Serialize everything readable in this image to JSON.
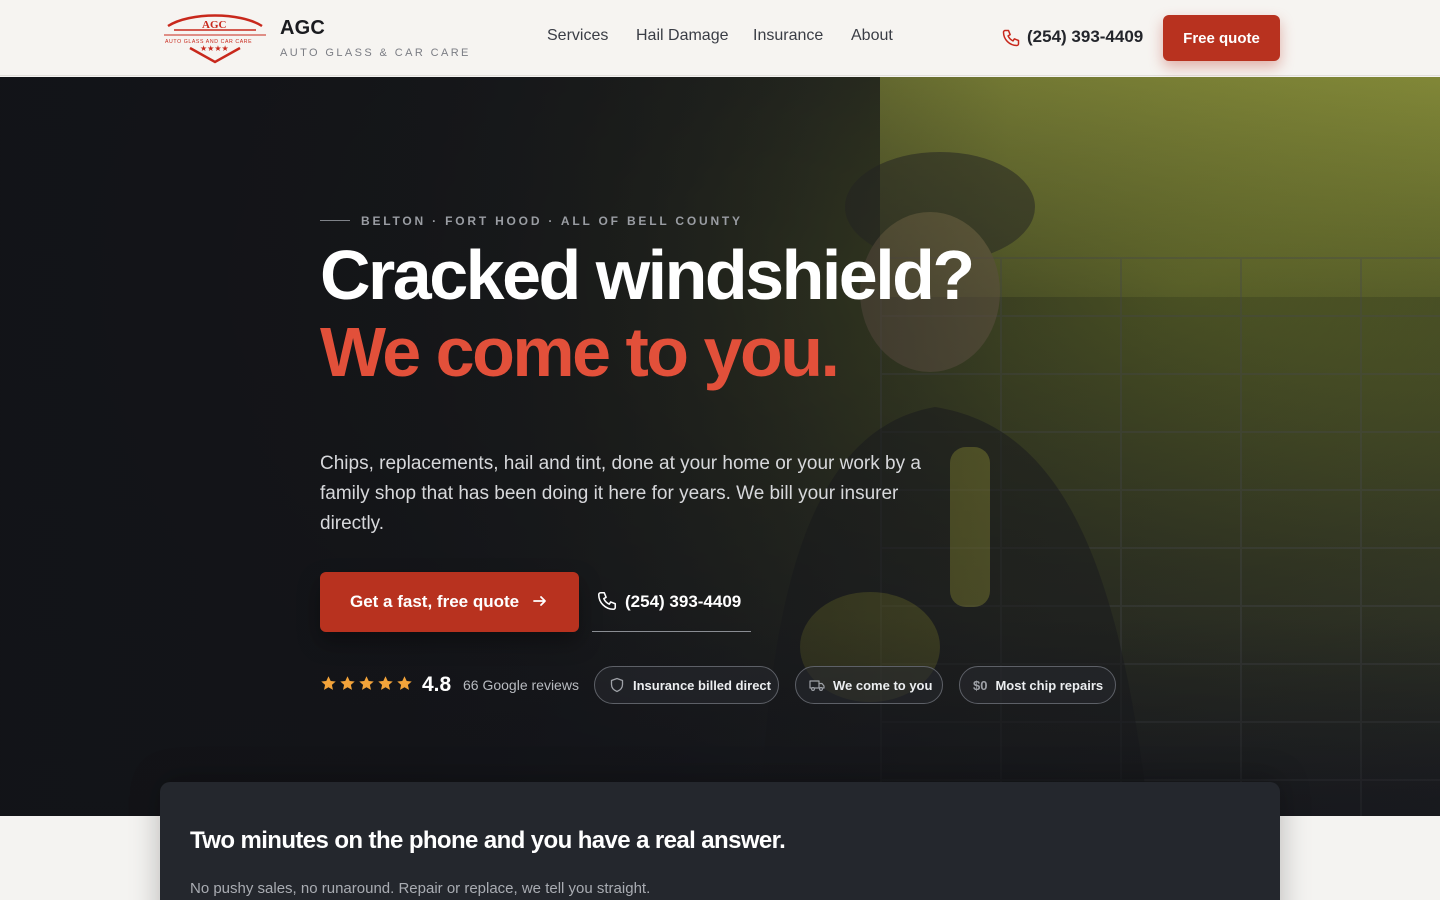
{
  "header": {
    "logo_text": "AGC",
    "logo_subtext": "AUTO GLASS AND CAR CARE",
    "brand_name": "AGC",
    "brand_tagline": "AUTO GLASS & CAR CARE",
    "nav": [
      "Services",
      "Hail Damage",
      "Insurance",
      "About"
    ],
    "phone": "(254) 393-4409",
    "quote_button": "Free quote"
  },
  "hero": {
    "eyebrow": "BELTON · FORT HOOD · ALL OF BELL COUNTY",
    "headline_1": "Cracked windshield?",
    "headline_2": "We come to you.",
    "lead": "Chips, replacements, hail and tint, done at your home or your work by a family shop that has been doing it here for years. We bill your insurer directly.",
    "cta_primary": "Get a fast, free quote",
    "cta_phone": "(254) 393-4409",
    "rating": "4.8",
    "stars": 5,
    "reviews": "66 Google reviews",
    "pills": [
      {
        "icon": "shield-icon",
        "label": "Insurance billed direct"
      },
      {
        "icon": "truck-icon",
        "label": "We come to you"
      },
      {
        "icon": "dollar-text",
        "prefix": "$0",
        "label": "Most chip repairs"
      }
    ]
  },
  "card": {
    "title": "Two minutes on the phone and you have a real answer.",
    "subtitle": "No pushy sales, no runaround. Repair or replace, we tell you straight."
  },
  "colors": {
    "accent": "#b8321f",
    "headline_accent": "#e2503a",
    "star": "#f2a33a",
    "header_bg": "#f6f4f1",
    "card_bg": "#24272d"
  }
}
